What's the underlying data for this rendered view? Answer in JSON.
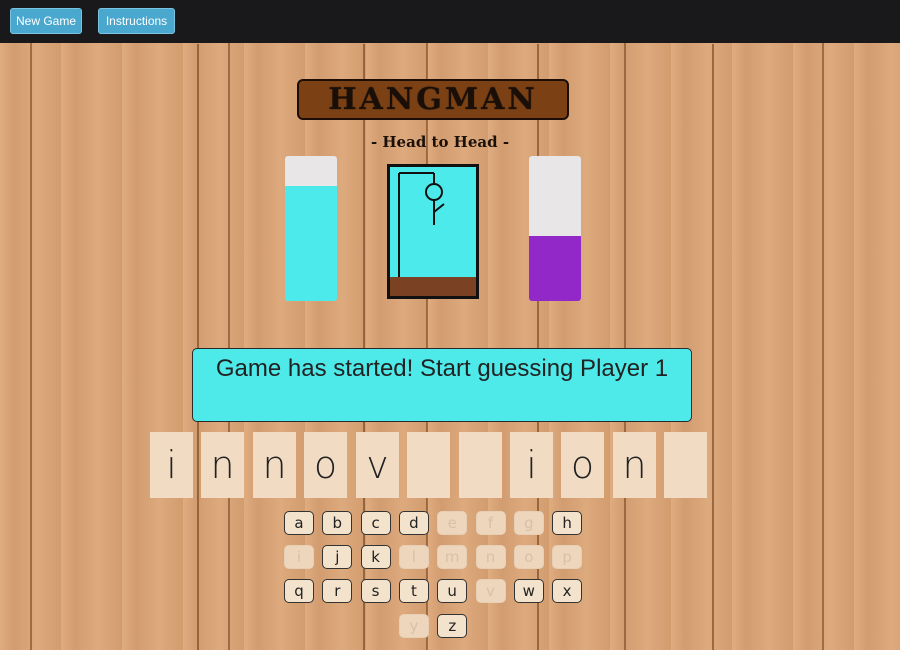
{
  "toolbar": {
    "new_game_label": "New Game",
    "instructions_label": "Instructions"
  },
  "header": {
    "title": "HANGMAN",
    "subtitle": "- Head to Head -"
  },
  "players": {
    "player1": {
      "color": "#4ceaea",
      "level": 0.79
    },
    "player2": {
      "color": "#9328c8",
      "level": 0.45
    }
  },
  "status_message": "Game has started! Start guessing Player 1",
  "word": [
    "i",
    "n",
    "n",
    "o",
    "v",
    "",
    "",
    "i",
    "o",
    "n",
    ""
  ],
  "keyboard": [
    {
      "letter": "a",
      "used": false
    },
    {
      "letter": "b",
      "used": false
    },
    {
      "letter": "c",
      "used": false
    },
    {
      "letter": "d",
      "used": false
    },
    {
      "letter": "e",
      "used": true
    },
    {
      "letter": "f",
      "used": true
    },
    {
      "letter": "g",
      "used": true
    },
    {
      "letter": "h",
      "used": false
    },
    {
      "letter": "i",
      "used": true
    },
    {
      "letter": "j",
      "used": false
    },
    {
      "letter": "k",
      "used": false
    },
    {
      "letter": "l",
      "used": true
    },
    {
      "letter": "m",
      "used": true
    },
    {
      "letter": "n",
      "used": true
    },
    {
      "letter": "o",
      "used": true
    },
    {
      "letter": "p",
      "used": true
    },
    {
      "letter": "q",
      "used": false
    },
    {
      "letter": "r",
      "used": false
    },
    {
      "letter": "s",
      "used": false
    },
    {
      "letter": "t",
      "used": false
    },
    {
      "letter": "u",
      "used": false
    },
    {
      "letter": "v",
      "used": true
    },
    {
      "letter": "w",
      "used": false
    },
    {
      "letter": "x",
      "used": false
    },
    {
      "letter": "y",
      "used": true
    },
    {
      "letter": "z",
      "used": false
    }
  ],
  "colors": {
    "ground": "#7a4222",
    "gallows_bg": "#4ceaea"
  }
}
